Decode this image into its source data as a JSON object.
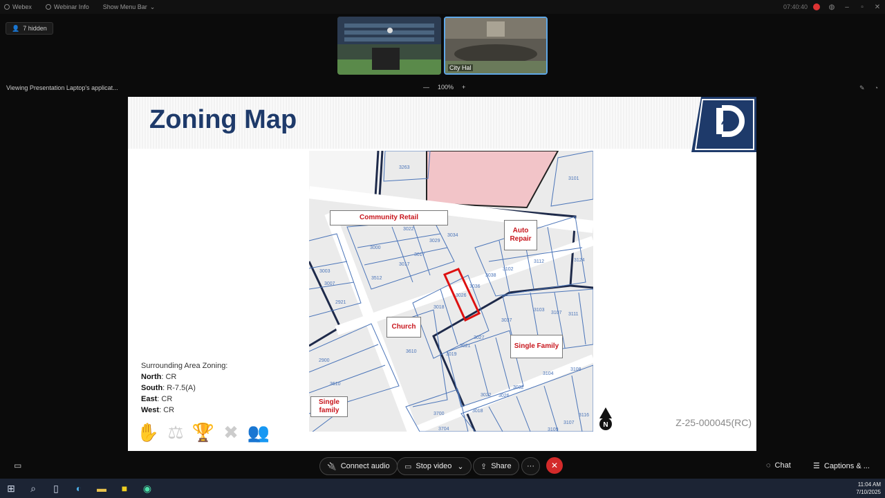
{
  "topbar": {
    "app_name": "Webex",
    "webinar_info": "Webinar Info",
    "show_menu_bar": "Show Menu Bar",
    "timer": "07:40:40"
  },
  "participants": {
    "hidden_label": "7 hidden",
    "video2_label": "City Hal"
  },
  "share": {
    "viewing_text": "Viewing Presentation Laptop's applicat...",
    "zoom_minus": "—",
    "zoom_level": "100%",
    "zoom_plus": "+"
  },
  "slide": {
    "title": "Zoning Map",
    "map_labels": {
      "community_retail": "Community Retail",
      "auto_repair": "Auto Repair",
      "church": "Church",
      "single_family_1": "Single Family",
      "single_family_2": "Single family"
    },
    "parcels": [
      "3263",
      "3101",
      "3022",
      "3000",
      "3034",
      "3029",
      "3017",
      "3017",
      "3512",
      "3112",
      "3124",
      "3102",
      "3003",
      "3007",
      "3038",
      "3036",
      "3026",
      "3018",
      "2921",
      "3103",
      "3107",
      "3111",
      "3027",
      "3037",
      "3021",
      "3019",
      "3610",
      "2900",
      "3610",
      "3032",
      "3104",
      "3108",
      "3022",
      "3026",
      "3018",
      "3700",
      "3704",
      "3116",
      "3107",
      "3109"
    ],
    "zoning_heading": "Surrounding Area Zoning:",
    "zoning": [
      {
        "dir": "North",
        "value": "CR"
      },
      {
        "dir": "South",
        "value": "R-7.5(A)"
      },
      {
        "dir": "East",
        "value": "CR"
      },
      {
        "dir": "West",
        "value": "CR"
      }
    ],
    "north_arrow": "N",
    "case_number": "Z-25-000045(RC)"
  },
  "controls": {
    "connect_audio": "Connect audio",
    "stop_video": "Stop video",
    "share": "Share",
    "more": "···",
    "chat": "Chat",
    "captions": "Captions & ..."
  },
  "taskbar": {
    "time": "11:04 AM",
    "date": "7/10/2025"
  }
}
